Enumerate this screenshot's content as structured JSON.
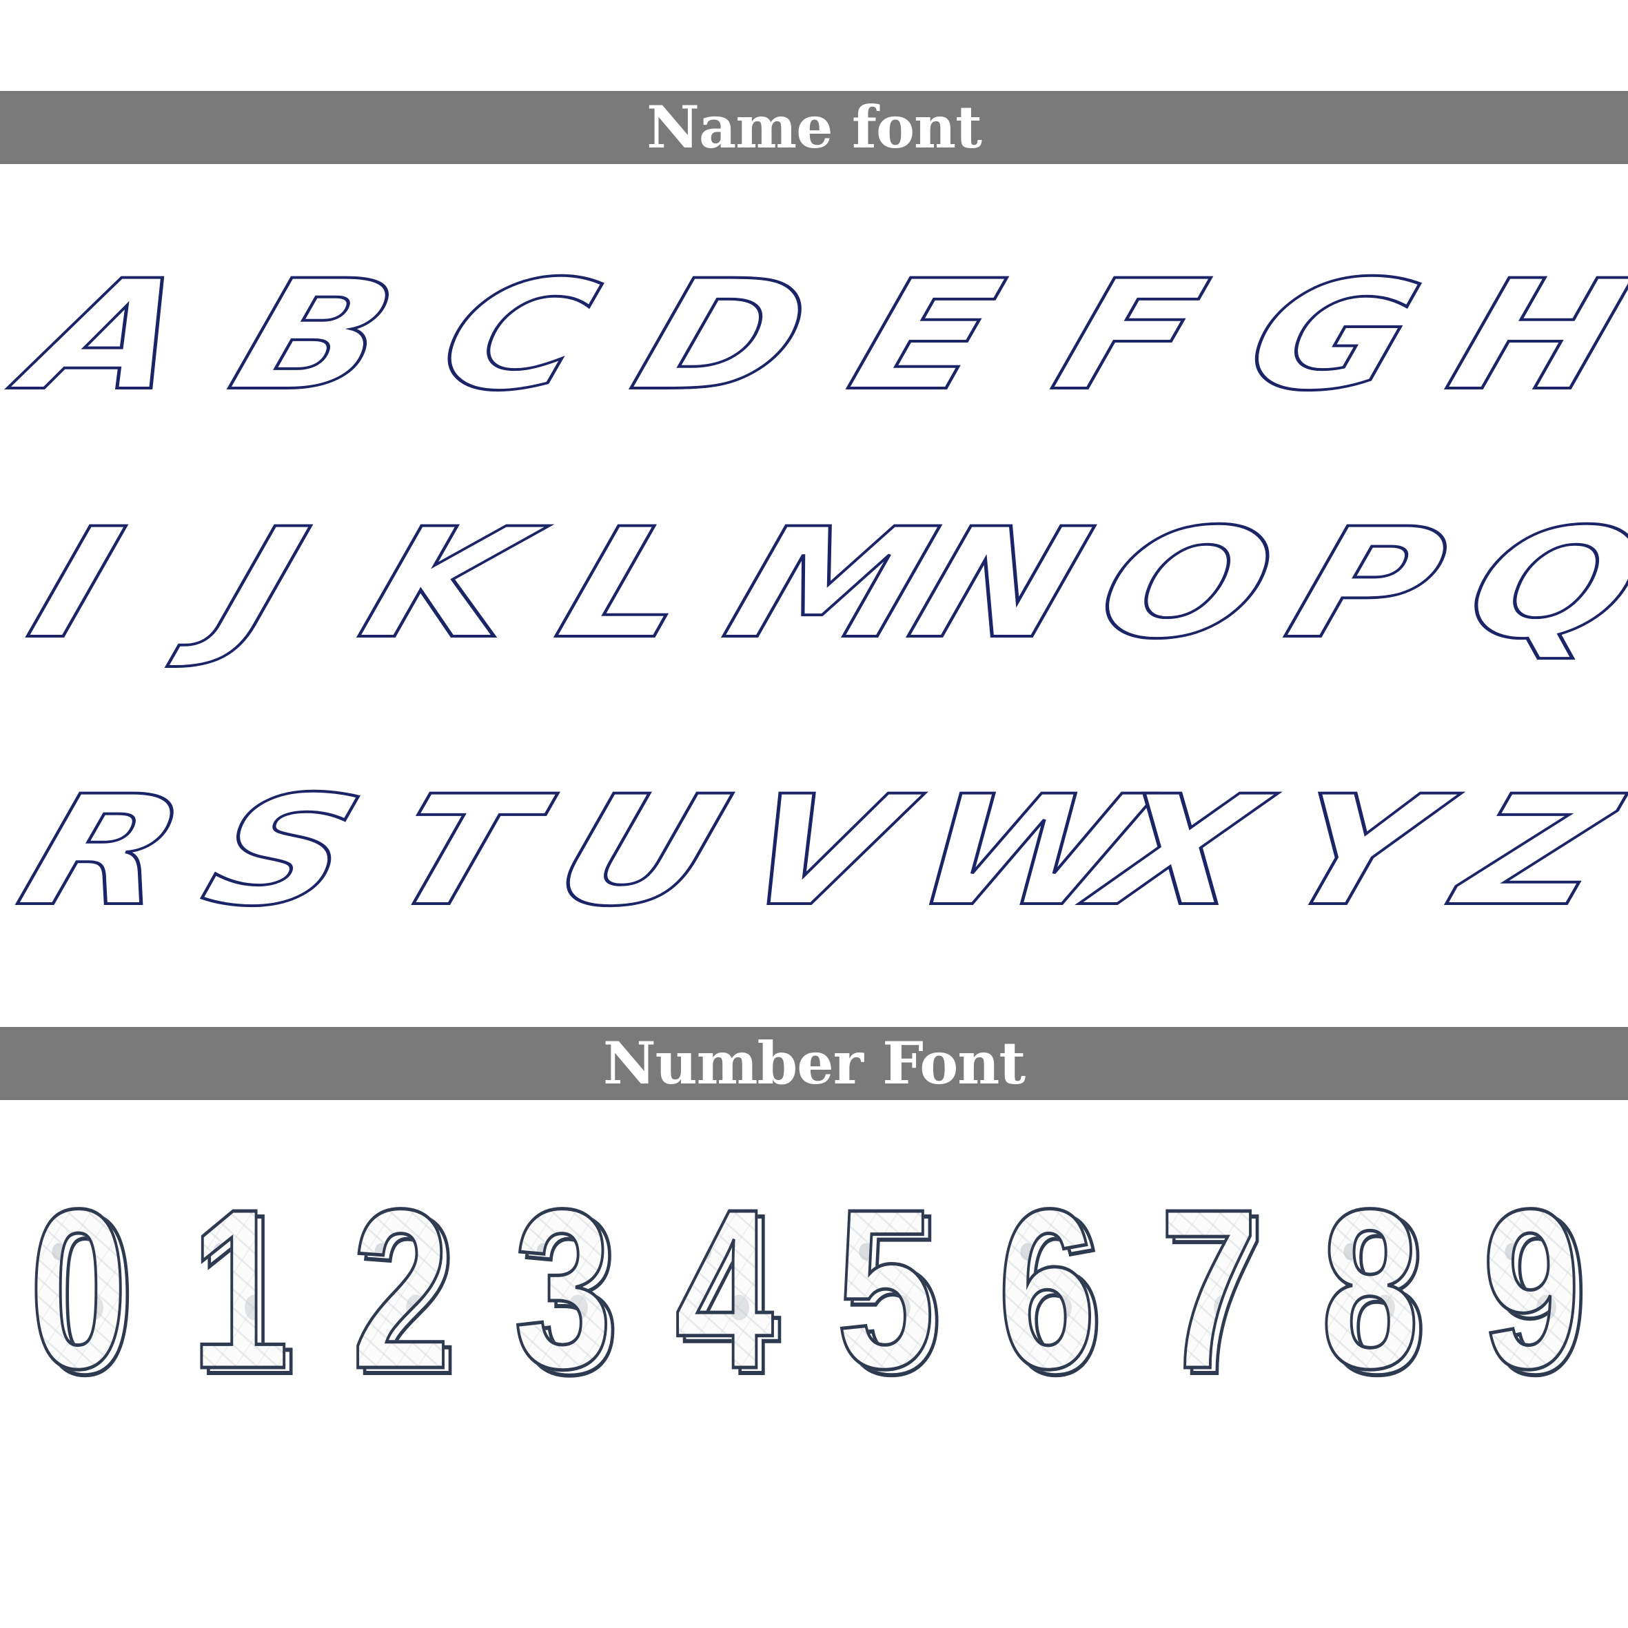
{
  "sections": {
    "name_font_title": "Name font",
    "number_font_title": "Number Font"
  },
  "letters": {
    "row1": [
      "A",
      "B",
      "C",
      "D",
      "E",
      "F",
      "G",
      "H"
    ],
    "row2": [
      "I",
      "J",
      "K",
      "L",
      "M",
      "N",
      "O",
      "P",
      "Q"
    ],
    "row3": [
      "R",
      "S",
      "T",
      "U",
      "V",
      "W",
      "X",
      "Y",
      "Z"
    ]
  },
  "digits": [
    "0",
    "1",
    "2",
    "3",
    "4",
    "5",
    "6",
    "7",
    "8",
    "9"
  ],
  "colors": {
    "banner": "#7a7a7a",
    "letter_outline": "#1a2466",
    "digit_outline": "#2d3a4f",
    "background": "#ffffff"
  }
}
